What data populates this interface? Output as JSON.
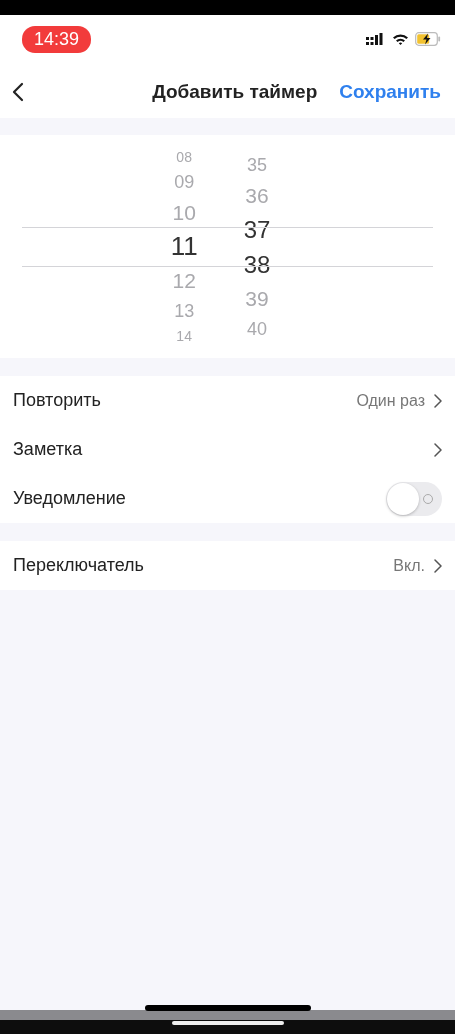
{
  "status_bar": {
    "time": "14:39",
    "charging": true
  },
  "nav": {
    "title": "Добавить таймер",
    "save": "Сохранить"
  },
  "picker": {
    "hours": [
      {
        "label": "08",
        "selected": false
      },
      {
        "label": "09",
        "selected": false
      },
      {
        "label": "10",
        "selected": false
      },
      {
        "label": "11",
        "selected": true
      },
      {
        "label": "12",
        "selected": false
      },
      {
        "label": "13",
        "selected": false
      },
      {
        "label": "14",
        "selected": false
      }
    ],
    "minutes": [
      {
        "label": "35",
        "selected": false
      },
      {
        "label": "36",
        "selected": false
      },
      {
        "label": "37",
        "selected": true
      },
      {
        "label": "38",
        "selected": true
      },
      {
        "label": "39",
        "selected": false
      },
      {
        "label": "40",
        "selected": false
      }
    ]
  },
  "groups": [
    {
      "rows": [
        {
          "kind": "link",
          "label": "Повторить",
          "value": "Один раз"
        },
        {
          "kind": "link",
          "label": "Заметка"
        },
        {
          "kind": "toggle",
          "label": "Уведомление",
          "on": false
        }
      ]
    },
    {
      "rows": [
        {
          "kind": "link",
          "label": "Переключатель",
          "value": "Вкл."
        }
      ]
    }
  ]
}
